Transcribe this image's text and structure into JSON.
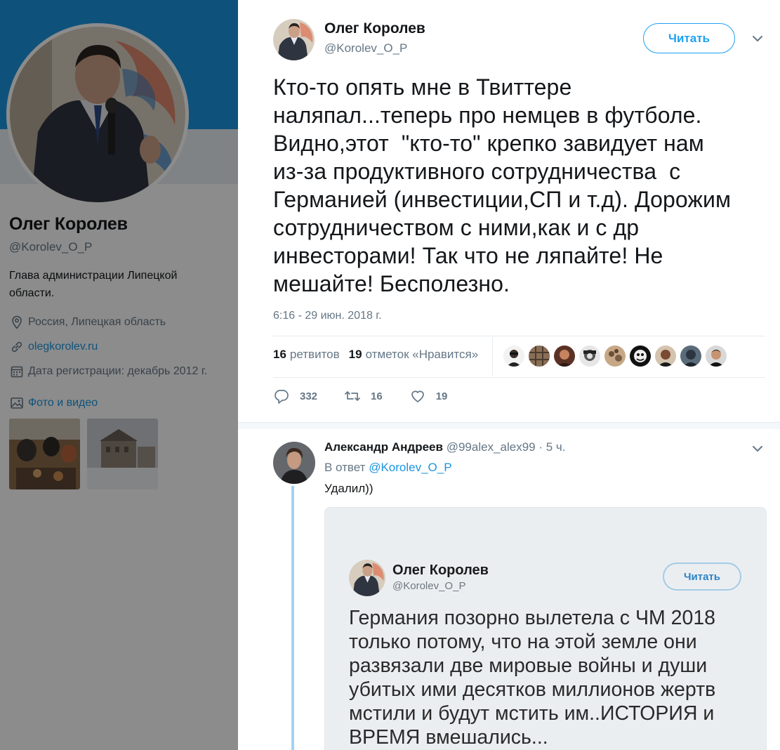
{
  "profile": {
    "name": "Олег Королев",
    "handle": "@Korolev_O_P",
    "bio": "Глава администрации Липецкой области.",
    "location": "Россия, Липецкая область",
    "website": "olegkorolev.ru",
    "joined": "Дата регистрации: декабрь 2012 г.",
    "media_label": "Фото и видео"
  },
  "tweet": {
    "author_name": "Олег Королев",
    "author_handle": "@Korolev_O_P",
    "follow_label": "Читать",
    "text": "Кто-то опять мне в Твиттере\nналяпал...теперь про немцев в футболе.\nВидно,этот  \"кто-то\" крепко завидует нам\nиз-за продуктивного сотрудничества  с\nГерманией (инвестиции,СП и т.д). Дорожим\nсотрудничеством с ними,как и с др\nинвесторами! Так что не ляпайте! Не\nмешайте! Бесполезно.",
    "timestamp": "6:16 - 29 июн. 2018 г.",
    "retweets_count": "16",
    "retweets_label": "ретвитов",
    "likes_count": "19",
    "likes_label": "отметок «Нравится»",
    "reply_count": "332",
    "retweet_action_count": "16",
    "like_action_count": "19"
  },
  "reply": {
    "author_name": "Александр Андреев",
    "author_handle": "@99alex_alex99",
    "time": "· 5 ч.",
    "in_reply_prefix": "В ответ",
    "in_reply_to": "@Korolev_O_P",
    "text": "Удалил))",
    "media": {
      "name": "Олег Королев",
      "handle": "@Korolev_O_P",
      "button": "Читать",
      "text": "Германия позорно вылетела с ЧМ 2018\nтолько потому, что на этой земле они\nразвязали две мировые войны и души\nубитых ими десятков миллионов жертв\nмстили и будут мстить им..ИСТОРИЯ и\nВРЕМЯ вмешались..."
    }
  },
  "colors": {
    "brand": "#1da1f2",
    "link": "#1b95e0",
    "muted": "#657786",
    "thread_line": "#a0d3f5"
  }
}
